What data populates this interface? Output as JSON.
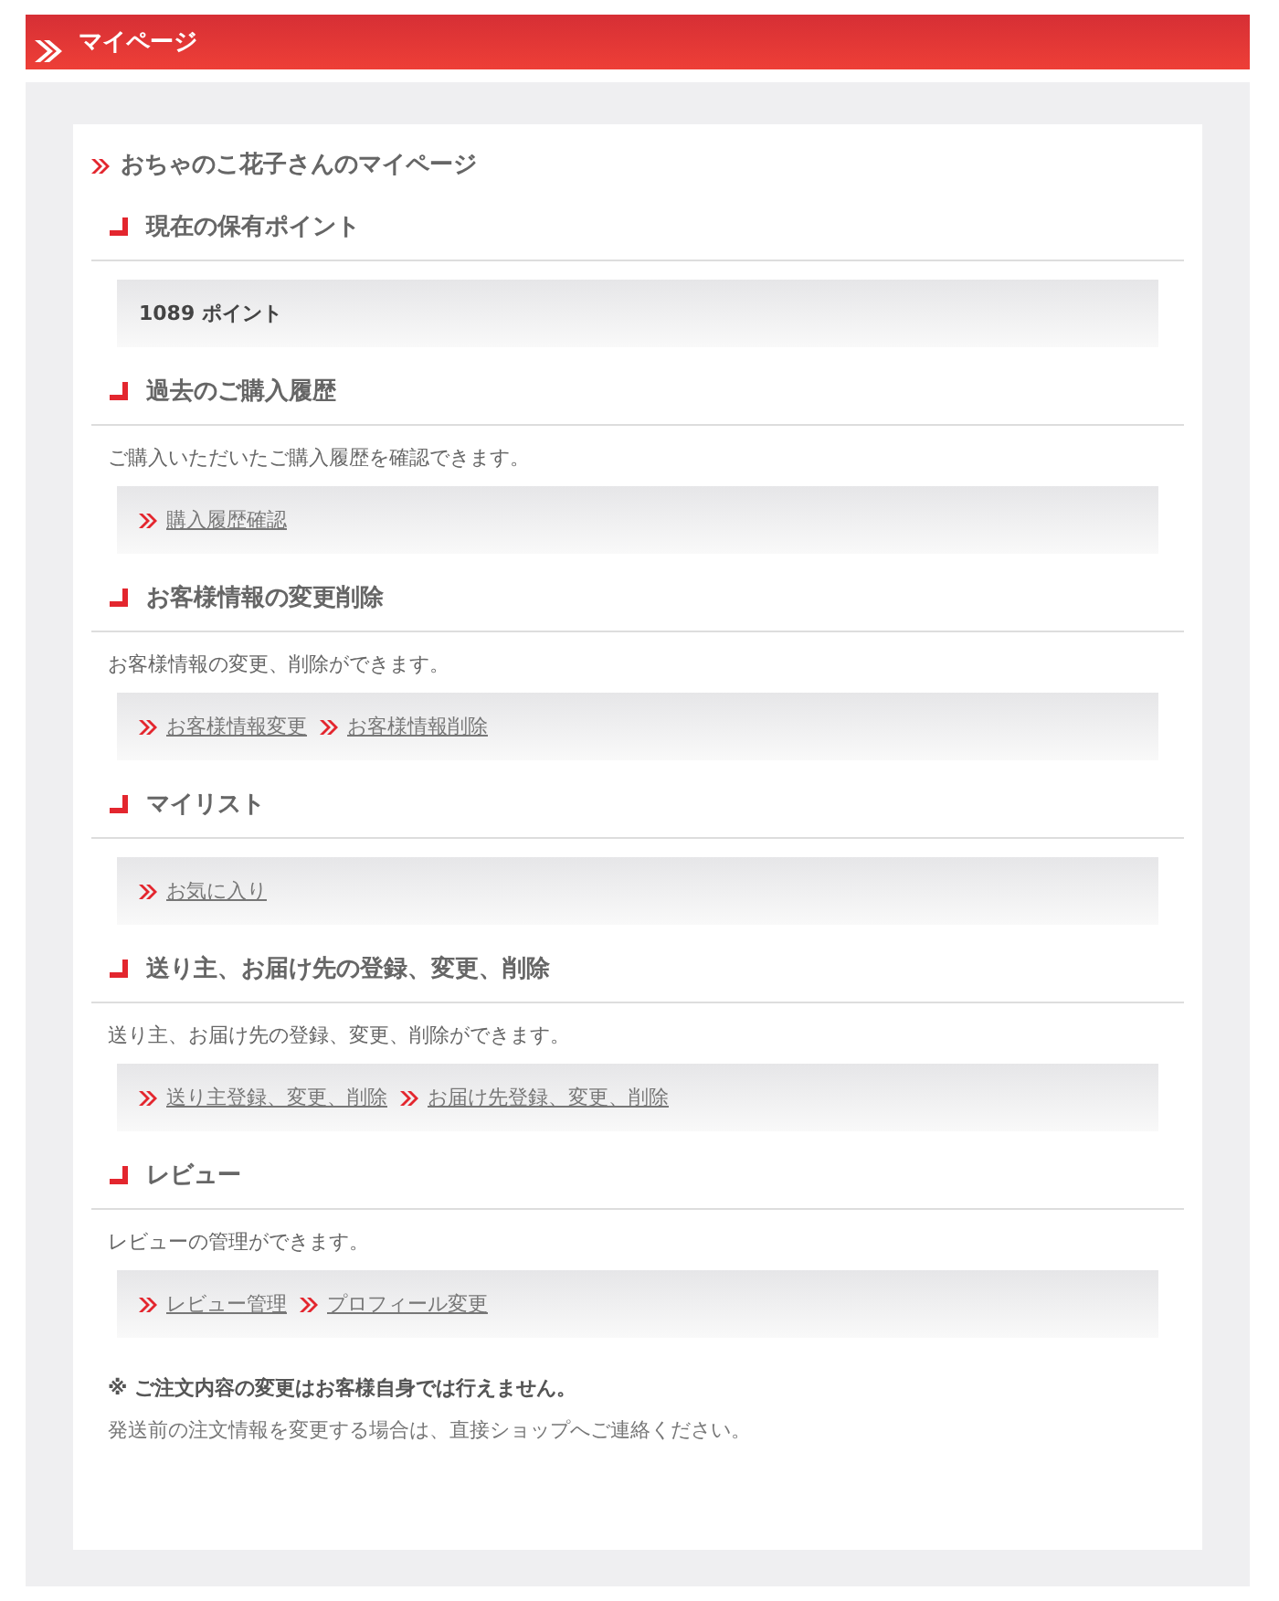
{
  "header": {
    "title": "マイページ"
  },
  "page_title": "おちゃのこ花子さんのマイページ",
  "sections": [
    {
      "heading": "現在の保有ポイント",
      "kind": "points",
      "value": "1089 ポイント"
    },
    {
      "heading": "過去のご購入履歴",
      "kind": "links",
      "description": "ご購入いただいたご購入履歴を確認できます。",
      "links": [
        "購入履歴確認"
      ]
    },
    {
      "heading": "お客様情報の変更削除",
      "kind": "links",
      "description": "お客様情報の変更、削除ができます。",
      "links": [
        "お客様情報変更",
        "お客様情報削除"
      ]
    },
    {
      "heading": "マイリスト",
      "kind": "links",
      "links": [
        "お気に入り"
      ]
    },
    {
      "heading": "送り主、お届け先の登録、変更、削除",
      "kind": "links",
      "description": "送り主、お届け先の登録、変更、削除ができます。",
      "links": [
        "送り主登録、変更、削除",
        "お届け先登録、変更、削除"
      ]
    },
    {
      "heading": "レビュー",
      "kind": "links",
      "description": "レビューの管理ができます。",
      "links": [
        "レビュー管理",
        "プロフィール変更"
      ]
    }
  ],
  "note": {
    "title": "※ ご注文内容の変更はお客様自身では行えません。",
    "text": "発送前の注文情報を変更する場合は、直接ショップへご連絡ください。"
  }
}
